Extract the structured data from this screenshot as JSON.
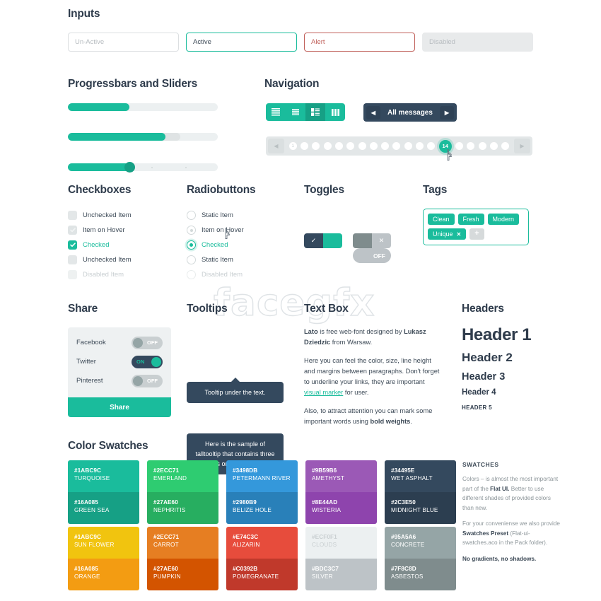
{
  "watermark": "facegfx",
  "sections": {
    "inputs": "Inputs",
    "progressbars": "Progressbars and Sliders",
    "navigation": "Navigation",
    "checkboxes": "Checkboxes",
    "radiobuttons": "Radiobuttons",
    "toggles": "Toggles",
    "tags": "Tags",
    "share": "Share",
    "tooltips": "Tooltips",
    "textbox": "Text Box",
    "headers": "Headers",
    "swatches": "Color Swatches"
  },
  "inputs": [
    {
      "value": "Un-Active",
      "state": "unactive"
    },
    {
      "value": "Active",
      "state": "active"
    },
    {
      "value": "Alert",
      "state": "alert"
    },
    {
      "value": "Disabled",
      "state": "disabled"
    }
  ],
  "progress": {
    "bars": [
      {
        "percent": 41
      },
      {
        "percent": 65,
        "buffer": 75
      }
    ],
    "slider": {
      "percent": 41
    }
  },
  "navigation": {
    "view_modes": [
      "list-view-icon",
      "compact-list-icon",
      "grid-view-icon",
      "columns-view-icon"
    ],
    "active_view_index": 2,
    "message_nav": {
      "prev": "◀",
      "label": "All messages",
      "next": "▶"
    },
    "pagination": {
      "prev": "◀",
      "next": "▶",
      "first_page": "1",
      "current_page": "14",
      "total_dots": 19,
      "current_index": 13
    }
  },
  "checkboxes": [
    {
      "label": "Unchecked Item",
      "state": "unchecked"
    },
    {
      "label": "Item on Hover",
      "state": "hover"
    },
    {
      "label": "Checked",
      "state": "checked"
    },
    {
      "label": "Unchecked Item",
      "state": "unchecked"
    },
    {
      "label": "Disabled Item",
      "state": "disabled"
    }
  ],
  "radiobuttons": [
    {
      "label": "Static Item",
      "state": "static"
    },
    {
      "label": "Item on Hover",
      "state": "hover"
    },
    {
      "label": "Checked",
      "state": "checked"
    },
    {
      "label": "Static Item",
      "state": "static"
    },
    {
      "label": "Disabled Item",
      "state": "disabled"
    }
  ],
  "toggles": {
    "on_label": "ON",
    "off_label": "OFF",
    "check_glyph": "✓",
    "cross_glyph": "✕"
  },
  "tags": {
    "items": [
      "Clean",
      "Fresh",
      "Modern"
    ],
    "removable": {
      "label": "Unique",
      "remove": "✕"
    },
    "add": "+"
  },
  "share": {
    "rows": [
      {
        "name": "Facebook",
        "state": "OFF"
      },
      {
        "name": "Twitter",
        "state": "ON"
      },
      {
        "name": "Pinterest",
        "state": "OFF"
      }
    ],
    "button": "Share"
  },
  "tooltips": {
    "short": "Tooltip under the text.",
    "tall": "Here is the sample of talltooltip that contains three lines or more. More."
  },
  "textbox": {
    "p1_lead": "Lato",
    "p1_mid": " is free web-font designed by  ",
    "p1_bold2": "Lukasz Dziedzic",
    "p1_end": " from Warsaw.",
    "p2_a": "Here you can feel the color, size, line height and margins between paragraphs. Don't forget to underline your links, they are important ",
    "p2_link": "visual marker",
    "p2_b": " for user.",
    "p3_a": "Also, to attract attention you can mark some important words using ",
    "p3_bold": "bold weights",
    "p3_b": "."
  },
  "headers": [
    {
      "text": "Header 1",
      "level": "h1"
    },
    {
      "text": "Header 2",
      "level": "h2"
    },
    {
      "text": "Header 3",
      "level": "h3"
    },
    {
      "text": "Header 4",
      "level": "h4"
    },
    {
      "text": "HEADER 5",
      "level": "h5"
    }
  ],
  "swatches": {
    "columns": [
      {
        "top": {
          "hex": "#1ABC9C",
          "name": "TURQUOISE",
          "color": "#1abc9c"
        },
        "bottom": {
          "hex": "#16A085",
          "name": "GREEN SEA",
          "color": "#16a085"
        }
      },
      {
        "top": {
          "hex": "#2ECC71",
          "name": "EMERLAND",
          "color": "#2ecc71"
        },
        "bottom": {
          "hex": "#27AE60",
          "name": "NEPHRITIS",
          "color": "#27ae60"
        }
      },
      {
        "top": {
          "hex": "#3498DB",
          "name": "PETERMANN RIVER",
          "color": "#3498db"
        },
        "bottom": {
          "hex": "#2980B9",
          "name": "BELIZE HOLE",
          "color": "#2980b9"
        }
      },
      {
        "top": {
          "hex": "#9B59B6",
          "name": "AMETHYST",
          "color": "#9b59b6"
        },
        "bottom": {
          "hex": "#8E44AD",
          "name": "WISTERIA",
          "color": "#8e44ad"
        }
      },
      {
        "top": {
          "hex": "#34495E",
          "name": "WET ASPHALT",
          "color": "#34495e"
        },
        "bottom": {
          "hex": "#2C3E50",
          "name": "MIDNIGHT BLUE",
          "color": "#2c3e50"
        }
      }
    ],
    "columns2": [
      {
        "top": {
          "hex": "#1ABC9C",
          "name": "SUN FLOWER",
          "color": "#f1c40f"
        },
        "bottom": {
          "hex": "#16A085",
          "name": "ORANGE",
          "color": "#f39c12"
        }
      },
      {
        "top": {
          "hex": "#2ECC71",
          "name": "CARROT",
          "color": "#e67e22"
        },
        "bottom": {
          "hex": "#27AE60",
          "name": "PUMPKIN",
          "color": "#d35400"
        }
      },
      {
        "top": {
          "hex": "#E74C3C",
          "name": "ALIZARIN",
          "color": "#e74c3c"
        },
        "bottom": {
          "hex": "#C0392B",
          "name": "POMEGRANATE",
          "color": "#c0392b"
        }
      },
      {
        "top": {
          "hex": "#ECF0F1",
          "name": "CLOUDS",
          "color": "#ecf0f1",
          "dark_text": true
        },
        "bottom": {
          "hex": "#BDC3C7",
          "name": "SILVER",
          "color": "#bdc3c7"
        }
      },
      {
        "top": {
          "hex": "#95A5A6",
          "name": "CONCRETE",
          "color": "#95a5a6"
        },
        "bottom": {
          "hex": "#7F8C8D",
          "name": "ASBESTOS",
          "color": "#7f8c8d"
        }
      }
    ],
    "description": {
      "title": "SWATCHES",
      "p1_a": "Colors – is almost the most important part of the ",
      "p1_b": "Flat UI.",
      "p1_c": " Better to use different shades of provided colors than new.",
      "p2_a": "For your conveniense we also provide ",
      "p2_b": "Swatches Preset",
      "p2_c": " (Flat-ui-swatches.aco in the Pack folder).",
      "p3": "No gradients, no shadows."
    }
  }
}
